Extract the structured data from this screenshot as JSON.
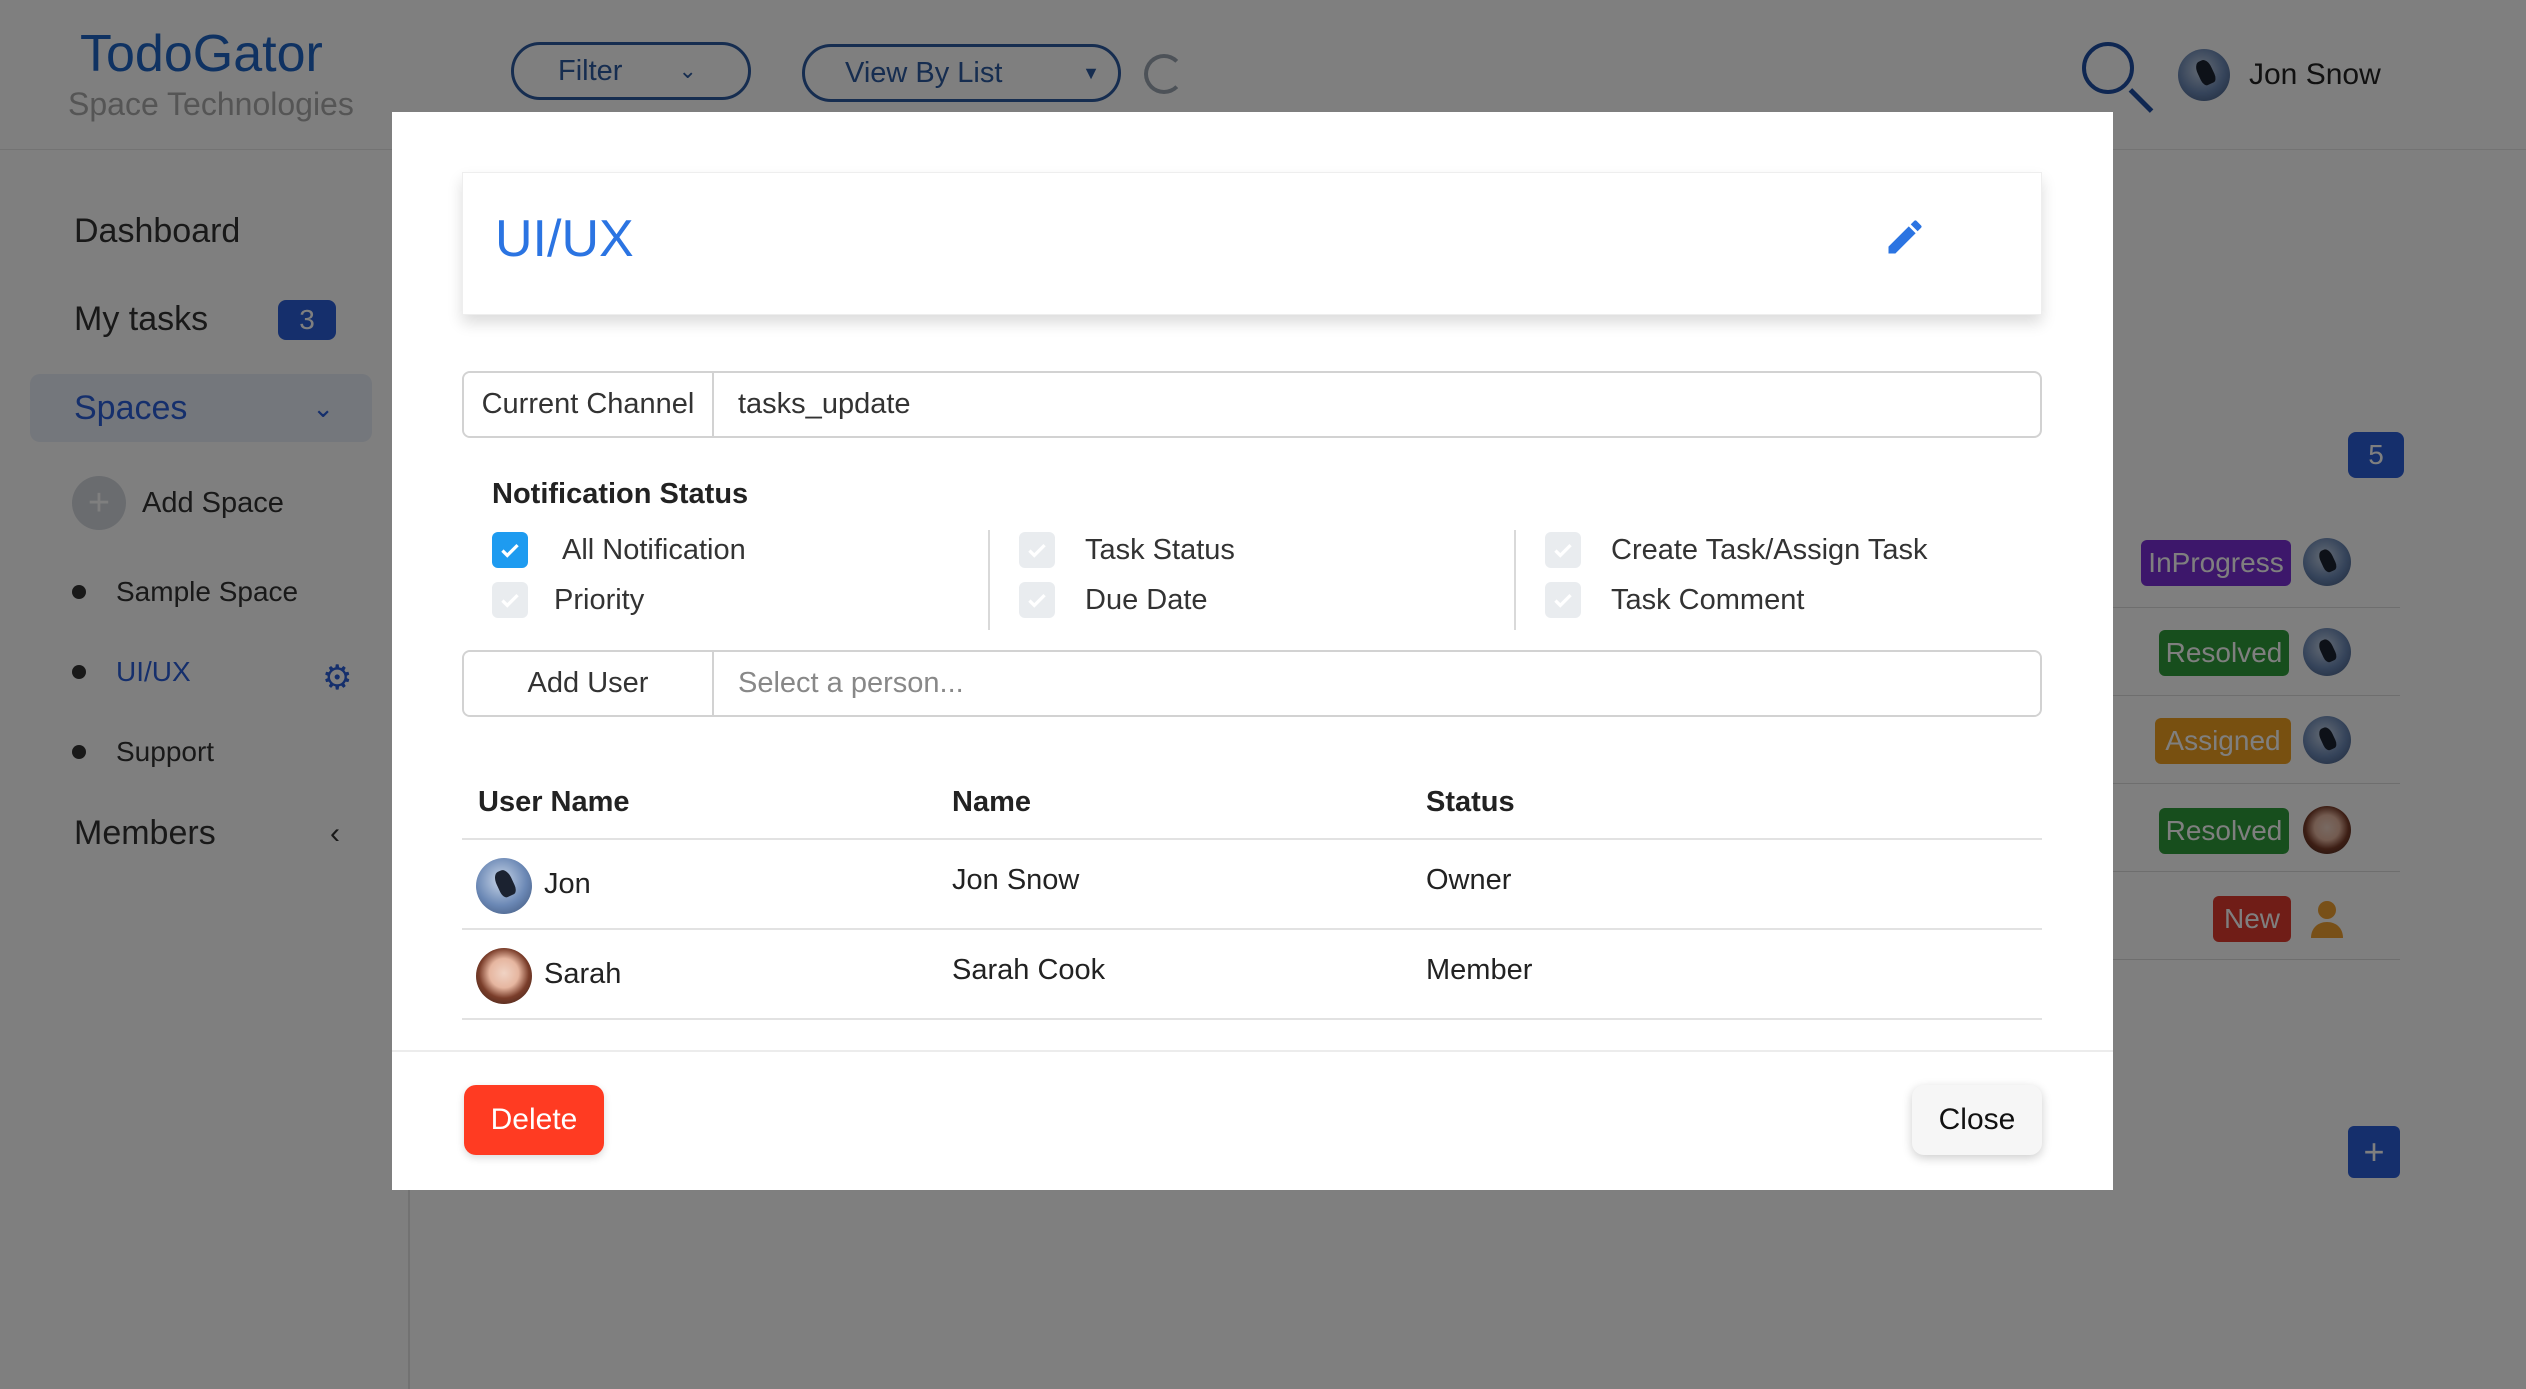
{
  "app": {
    "title": "TodoGator",
    "subtitle": "Space Technologies"
  },
  "header": {
    "filter_label": "Filter",
    "view_select": {
      "selected": "View By List"
    },
    "user_name": "Jon Snow"
  },
  "sidebar": {
    "dashboard": "Dashboard",
    "my_tasks": {
      "label": "My tasks",
      "count": "3"
    },
    "spaces": "Spaces",
    "add_space": "Add Space",
    "spaces_list": [
      "Sample Space",
      "UI/UX",
      "Support"
    ],
    "members": "Members"
  },
  "board": {
    "task_count": "5",
    "statuses": [
      {
        "label": "InProgress",
        "color": "#7b2fd6"
      },
      {
        "label": "Resolved",
        "color": "#2e9d3a"
      },
      {
        "label": "Assigned",
        "color": "#f0a020"
      },
      {
        "label": "Resolved",
        "color": "#2e9d3a"
      },
      {
        "label": "New",
        "color": "#e03a2e"
      }
    ]
  },
  "modal": {
    "space_title": "UI/UX",
    "channel": {
      "label": "Current Channel",
      "value": "tasks_update"
    },
    "notification": {
      "heading": "Notification Status",
      "options": [
        {
          "label": "All Notification",
          "checked": true
        },
        {
          "label": "Priority",
          "checked": false
        },
        {
          "label": "Task Status",
          "checked": false
        },
        {
          "label": "Due Date",
          "checked": false
        },
        {
          "label": "Create Task/Assign Task",
          "checked": false
        },
        {
          "label": "Task Comment",
          "checked": false
        }
      ]
    },
    "add_user": {
      "label": "Add User",
      "placeholder": "Select a person..."
    },
    "table": {
      "headers": [
        "User Name",
        "Name",
        "Status"
      ],
      "rows": [
        {
          "username": "Jon",
          "name": "Jon Snow",
          "status": "Owner"
        },
        {
          "username": "Sarah",
          "name": "Sarah Cook",
          "status": "Member"
        }
      ]
    },
    "delete_label": "Delete",
    "close_label": "Close"
  }
}
